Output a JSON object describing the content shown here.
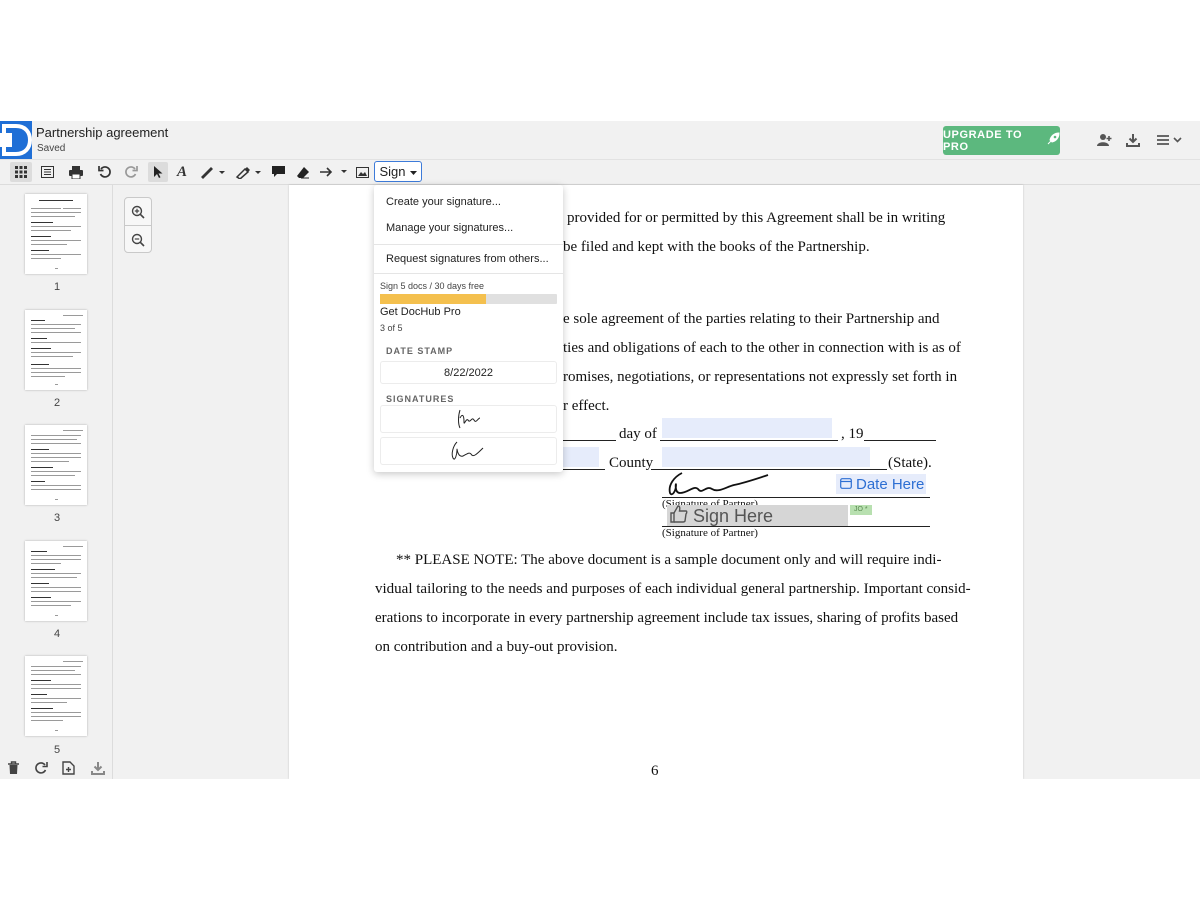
{
  "header": {
    "doc_title": "Partnership agreement",
    "doc_status": "Saved",
    "upgrade_label": "UPGRADE TO PRO",
    "icons": [
      "docHub-logo-icon",
      "rocket-icon",
      "add-user-icon",
      "download-icon",
      "menu-icon",
      "chevron-down-icon"
    ]
  },
  "toolbar": {
    "sign_label": "Sign",
    "tools": [
      "grid-view-icon",
      "list-view-icon",
      "print-icon",
      "undo-icon",
      "redo-icon",
      "select-icon",
      "text-icon",
      "pen-icon",
      "highlighter-icon",
      "comment-icon",
      "eraser-icon",
      "arrow-icon",
      "image-icon"
    ]
  },
  "sidebar": {
    "pages": [
      "1",
      "2",
      "3",
      "4",
      "5"
    ],
    "footer_icons": [
      "trash-icon",
      "rotate-icon",
      "add-page-icon",
      "download-icon"
    ]
  },
  "zoom": {
    "icons": [
      "zoom-in-icon",
      "zoom-out-icon"
    ]
  },
  "sign_menu": {
    "create": "Create your signature...",
    "manage": "Manage your signatures...",
    "request": "Request signatures from others...",
    "quota": "Sign 5 docs / 30 days free",
    "quota_used_fraction": 0.6,
    "promo": "Get DocHub Pro",
    "count": "3 of 5",
    "date_stamp_heading": "DATE STAMP",
    "date_value": "8/22/2022",
    "signatures_heading": "SIGNATURES"
  },
  "document": {
    "line1": "provided for or permitted by this Agreement shall be in writing",
    "line2": "be filed and kept with the books of the Partnership.",
    "line3": "e sole agreement of the parties relating to their Partnership and",
    "line4": "ties and obligations of each to the other in connection with is as of",
    "line5": "romises, negotiations, or representations not expressly set forth in",
    "line6": "r effect.",
    "day_of": "day of",
    "year_prefix": ", 19",
    "county": "County",
    "state": "(State).",
    "sig_partner_1": "(Signature of Partner)",
    "sig_partner_2": "(Signature of Partner)",
    "date_here": "Date Here",
    "sign_here": "Sign Here",
    "jo_tag": "JO *",
    "note1": "** PLEASE NOTE:  The above document is a sample document only and will require indi-",
    "note2": "vidual tailoring to the needs and purposes of each individual general partnership. Important consid-",
    "note3": "erations to incorporate in every partnership agreement include tax issues, sharing of profits based",
    "note4": "on contribution and a buy-out provision.",
    "page_number": "6"
  }
}
